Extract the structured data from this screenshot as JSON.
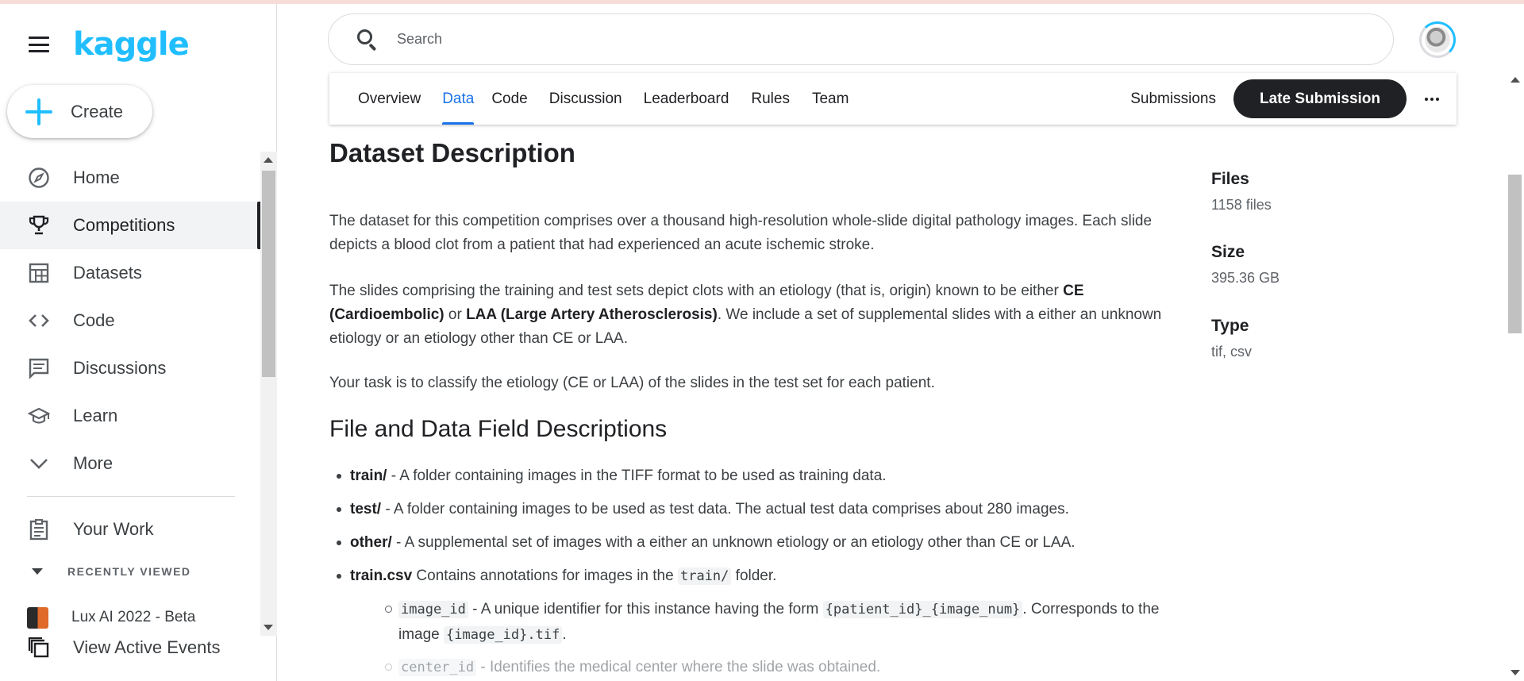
{
  "brand": {
    "logo": "kaggle"
  },
  "create": {
    "label": "Create"
  },
  "nav": {
    "items": [
      {
        "label": "Home",
        "icon": "compass-icon"
      },
      {
        "label": "Competitions",
        "icon": "trophy-icon",
        "active": true
      },
      {
        "label": "Datasets",
        "icon": "table-icon"
      },
      {
        "label": "Code",
        "icon": "code-icon"
      },
      {
        "label": "Discussions",
        "icon": "comments-icon"
      },
      {
        "label": "Learn",
        "icon": "school-icon"
      },
      {
        "label": "More",
        "icon": "chevron-down-icon"
      }
    ],
    "your_work": "Your Work",
    "recently_viewed": "RECENTLY VIEWED",
    "recent_item": "Lux AI 2022 - Beta",
    "active_events": "View Active Events"
  },
  "search": {
    "placeholder": "Search"
  },
  "tabs": {
    "items": [
      "Overview",
      "Data",
      "Code",
      "Discussion",
      "Leaderboard",
      "Rules",
      "Team"
    ],
    "active": "Data",
    "submissions": "Submissions",
    "late_submission": "Late Submission"
  },
  "content": {
    "title": "Dataset Description",
    "p1": "The dataset for this competition comprises over a thousand high-resolution whole-slide digital pathology images. Each slide depicts a blood clot from a patient that had experienced an acute ischemic stroke.",
    "p2_a": "The slides comprising the training and test sets depict clots with an etiology (that is, origin) known to be either ",
    "p2_ce": "CE (Cardioembolic)",
    "p2_or": " or ",
    "p2_laa": "LAA (Large Artery Atherosclerosis)",
    "p2_b": ". We include a set of supplemental slides with a either an unknown etiology or an etiology other than CE or LAA.",
    "p3": "Your task is to classify the etiology (CE or LAA) of the slides in the test set for each patient.",
    "fields_title": "File and Data Field Descriptions",
    "bullets": [
      {
        "name": "train/",
        "text": " - A folder containing images in the TIFF format to be used as training data."
      },
      {
        "name": "test/",
        "text": " - A folder containing images to be used as test data. The actual test data comprises about 280 images."
      },
      {
        "name": "other/",
        "text": " - A supplemental set of images with a either an unknown etiology or an etiology other than CE or LAA."
      },
      {
        "name": "train.csv",
        "text_a": " Contains annotations for images in the ",
        "code": "train/",
        "text_b": " folder."
      }
    ],
    "sub1": {
      "code": "image_id",
      "text_a": " - A unique identifier for this instance having the form ",
      "code2": "{patient_id}_{image_num}",
      "text_b": ". Corresponds to the image ",
      "code3": "{image_id}.tif",
      "text_c": "."
    },
    "sub2": {
      "code": "center_id",
      "text": " - Identifies the medical center where the slide was obtained."
    }
  },
  "meta": {
    "files_label": "Files",
    "files_value": "1158 files",
    "size_label": "Size",
    "size_value": "395.36 GB",
    "type_label": "Type",
    "type_value": "tif, csv"
  },
  "colors": {
    "accent": "#20beff",
    "tab_active": "#1a73e8",
    "button_dark": "#202124"
  }
}
